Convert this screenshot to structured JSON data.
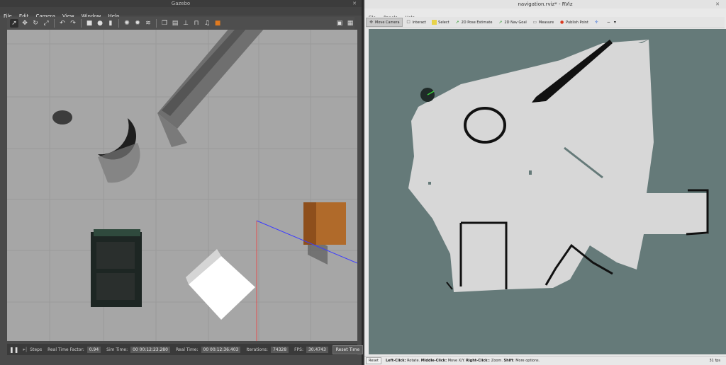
{
  "gazebo": {
    "title": "Gazebo",
    "menu": [
      "File",
      "Edit",
      "Camera",
      "View",
      "Window",
      "Help"
    ],
    "toolbar_icons": [
      "select-arrow-icon",
      "translate-icon",
      "rotate-icon",
      "scale-icon",
      "undo-icon",
      "redo-icon",
      "box-icon",
      "sphere-icon",
      "cylinder-icon",
      "point-light-icon",
      "spot-light-icon",
      "directional-light-icon",
      "copy-icon",
      "paste-icon",
      "align-icon",
      "snap-icon",
      "audio-icon",
      "color-icon",
      "screenshot-icon",
      "record-icon"
    ],
    "status": {
      "steps_label": "Steps",
      "rtf_label": "Real Time Factor:",
      "rtf_value": "0.94",
      "sim_time_label": "Sim Time:",
      "sim_time_value": "00 00:12:23.280",
      "real_time_label": "Real Time:",
      "real_time_value": "00 00:12:36.403",
      "iterations_label": "Iterations:",
      "iterations_value": "74328",
      "fps_label": "FPS:",
      "fps_value": "30.4743",
      "reset_time_label": "Reset Time"
    }
  },
  "rviz": {
    "title": "navigation.rviz* - RViz",
    "menu": [
      "File",
      "Panels",
      "Help"
    ],
    "tools": [
      {
        "label": "Move Camera",
        "icon": "move-camera-icon",
        "color": "#555555"
      },
      {
        "label": "Interact",
        "icon": "interact-icon",
        "color": "#555555"
      },
      {
        "label": "Select",
        "icon": "select-icon",
        "color": "#e8d34a"
      },
      {
        "label": "2D Pose Estimate",
        "icon": "pose-estimate-icon",
        "color": "#2e9b2e"
      },
      {
        "label": "2D Nav Goal",
        "icon": "nav-goal-icon",
        "color": "#2e9b2e"
      },
      {
        "label": "Measure",
        "icon": "measure-icon",
        "color": "#666666"
      },
      {
        "label": "Publish Point",
        "icon": "publish-point-icon",
        "color": "#d9381e"
      }
    ],
    "status": {
      "reset_label": "Reset",
      "hint_left_click": "Left-Click:",
      "hint_left_action": " Rotate. ",
      "hint_middle_click": "Middle-Click:",
      "hint_middle_action": " Move X/Y. ",
      "hint_right_click": "Right-Click:",
      "hint_right_action": ": Zoom. ",
      "hint_shift": "Shift",
      "hint_shift_action": ": More options.",
      "fps": "31 fps"
    }
  },
  "colors": {
    "map_free": "#d7d7d7",
    "map_unknown": "#657a79",
    "map_occupied": "#111111",
    "gazebo_ground": "#a6a6a6"
  }
}
